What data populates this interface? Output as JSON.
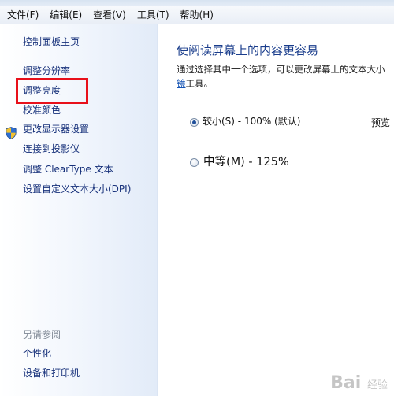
{
  "menubar": {
    "items": [
      {
        "label": "文件(F)"
      },
      {
        "label": "编辑(E)"
      },
      {
        "label": "查看(V)"
      },
      {
        "label": "工具(T)"
      },
      {
        "label": "帮助(H)"
      }
    ]
  },
  "sidebar": {
    "home": "控制面板主页",
    "links": [
      {
        "label": "调整分辨率"
      },
      {
        "label": "调整亮度"
      },
      {
        "label": "校准颜色",
        "icon": "shield-icon"
      },
      {
        "label": "更改显示器设置"
      },
      {
        "label": "连接到投影仪"
      },
      {
        "label": "调整 ClearType 文本"
      },
      {
        "label": "设置自定义文本大小(DPI)"
      }
    ],
    "see_also_title": "另请参阅",
    "see_also": [
      {
        "label": "个性化"
      },
      {
        "label": "设备和打印机"
      }
    ],
    "highlight_color": "#e8101a"
  },
  "main": {
    "title": "使阅读屏幕上的内容更容易",
    "description_line1": "通过选择其中一个选项，可以更改屏幕上的文本大小",
    "description_link": "镜",
    "description_line2_rest": "工具。",
    "options": [
      {
        "label": "较小(S) - 100% (默认)",
        "selected": true
      },
      {
        "label": "中等(M) - 125%",
        "selected": false
      }
    ],
    "preview_label": "预览"
  },
  "watermark": {
    "text": "Bai",
    "subtext": "经验"
  },
  "colors": {
    "link": "#16307a",
    "title": "#1a3d8c",
    "sidebar_gradient_end": "#e2ebf8"
  }
}
